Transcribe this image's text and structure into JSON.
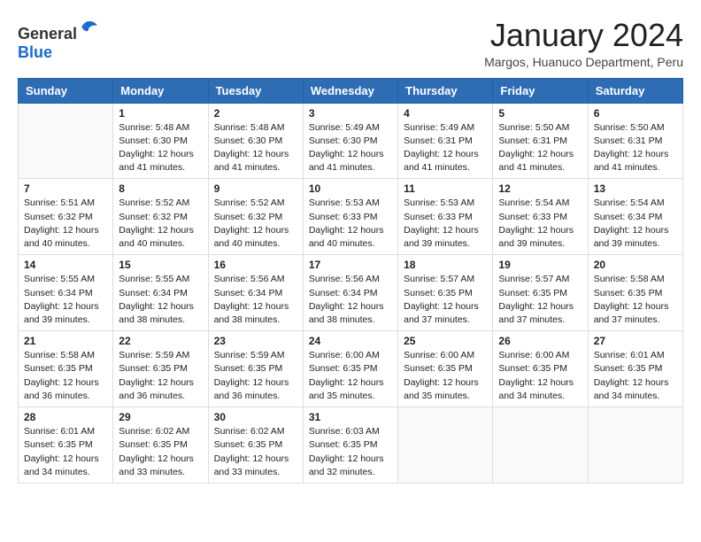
{
  "header": {
    "logo_general": "General",
    "logo_blue": "Blue",
    "month_title": "January 2024",
    "location": "Margos, Huanuco Department, Peru"
  },
  "weekdays": [
    "Sunday",
    "Monday",
    "Tuesday",
    "Wednesday",
    "Thursday",
    "Friday",
    "Saturday"
  ],
  "weeks": [
    [
      {
        "day": "",
        "empty": true
      },
      {
        "day": "1",
        "sunrise": "Sunrise: 5:48 AM",
        "sunset": "Sunset: 6:30 PM",
        "daylight": "Daylight: 12 hours and 41 minutes."
      },
      {
        "day": "2",
        "sunrise": "Sunrise: 5:48 AM",
        "sunset": "Sunset: 6:30 PM",
        "daylight": "Daylight: 12 hours and 41 minutes."
      },
      {
        "day": "3",
        "sunrise": "Sunrise: 5:49 AM",
        "sunset": "Sunset: 6:30 PM",
        "daylight": "Daylight: 12 hours and 41 minutes."
      },
      {
        "day": "4",
        "sunrise": "Sunrise: 5:49 AM",
        "sunset": "Sunset: 6:31 PM",
        "daylight": "Daylight: 12 hours and 41 minutes."
      },
      {
        "day": "5",
        "sunrise": "Sunrise: 5:50 AM",
        "sunset": "Sunset: 6:31 PM",
        "daylight": "Daylight: 12 hours and 41 minutes."
      },
      {
        "day": "6",
        "sunrise": "Sunrise: 5:50 AM",
        "sunset": "Sunset: 6:31 PM",
        "daylight": "Daylight: 12 hours and 41 minutes."
      }
    ],
    [
      {
        "day": "7",
        "sunrise": "Sunrise: 5:51 AM",
        "sunset": "Sunset: 6:32 PM",
        "daylight": "Daylight: 12 hours and 40 minutes."
      },
      {
        "day": "8",
        "sunrise": "Sunrise: 5:52 AM",
        "sunset": "Sunset: 6:32 PM",
        "daylight": "Daylight: 12 hours and 40 minutes."
      },
      {
        "day": "9",
        "sunrise": "Sunrise: 5:52 AM",
        "sunset": "Sunset: 6:32 PM",
        "daylight": "Daylight: 12 hours and 40 minutes."
      },
      {
        "day": "10",
        "sunrise": "Sunrise: 5:53 AM",
        "sunset": "Sunset: 6:33 PM",
        "daylight": "Daylight: 12 hours and 40 minutes."
      },
      {
        "day": "11",
        "sunrise": "Sunrise: 5:53 AM",
        "sunset": "Sunset: 6:33 PM",
        "daylight": "Daylight: 12 hours and 39 minutes."
      },
      {
        "day": "12",
        "sunrise": "Sunrise: 5:54 AM",
        "sunset": "Sunset: 6:33 PM",
        "daylight": "Daylight: 12 hours and 39 minutes."
      },
      {
        "day": "13",
        "sunrise": "Sunrise: 5:54 AM",
        "sunset": "Sunset: 6:34 PM",
        "daylight": "Daylight: 12 hours and 39 minutes."
      }
    ],
    [
      {
        "day": "14",
        "sunrise": "Sunrise: 5:55 AM",
        "sunset": "Sunset: 6:34 PM",
        "daylight": "Daylight: 12 hours and 39 minutes."
      },
      {
        "day": "15",
        "sunrise": "Sunrise: 5:55 AM",
        "sunset": "Sunset: 6:34 PM",
        "daylight": "Daylight: 12 hours and 38 minutes."
      },
      {
        "day": "16",
        "sunrise": "Sunrise: 5:56 AM",
        "sunset": "Sunset: 6:34 PM",
        "daylight": "Daylight: 12 hours and 38 minutes."
      },
      {
        "day": "17",
        "sunrise": "Sunrise: 5:56 AM",
        "sunset": "Sunset: 6:34 PM",
        "daylight": "Daylight: 12 hours and 38 minutes."
      },
      {
        "day": "18",
        "sunrise": "Sunrise: 5:57 AM",
        "sunset": "Sunset: 6:35 PM",
        "daylight": "Daylight: 12 hours and 37 minutes."
      },
      {
        "day": "19",
        "sunrise": "Sunrise: 5:57 AM",
        "sunset": "Sunset: 6:35 PM",
        "daylight": "Daylight: 12 hours and 37 minutes."
      },
      {
        "day": "20",
        "sunrise": "Sunrise: 5:58 AM",
        "sunset": "Sunset: 6:35 PM",
        "daylight": "Daylight: 12 hours and 37 minutes."
      }
    ],
    [
      {
        "day": "21",
        "sunrise": "Sunrise: 5:58 AM",
        "sunset": "Sunset: 6:35 PM",
        "daylight": "Daylight: 12 hours and 36 minutes."
      },
      {
        "day": "22",
        "sunrise": "Sunrise: 5:59 AM",
        "sunset": "Sunset: 6:35 PM",
        "daylight": "Daylight: 12 hours and 36 minutes."
      },
      {
        "day": "23",
        "sunrise": "Sunrise: 5:59 AM",
        "sunset": "Sunset: 6:35 PM",
        "daylight": "Daylight: 12 hours and 36 minutes."
      },
      {
        "day": "24",
        "sunrise": "Sunrise: 6:00 AM",
        "sunset": "Sunset: 6:35 PM",
        "daylight": "Daylight: 12 hours and 35 minutes."
      },
      {
        "day": "25",
        "sunrise": "Sunrise: 6:00 AM",
        "sunset": "Sunset: 6:35 PM",
        "daylight": "Daylight: 12 hours and 35 minutes."
      },
      {
        "day": "26",
        "sunrise": "Sunrise: 6:00 AM",
        "sunset": "Sunset: 6:35 PM",
        "daylight": "Daylight: 12 hours and 34 minutes."
      },
      {
        "day": "27",
        "sunrise": "Sunrise: 6:01 AM",
        "sunset": "Sunset: 6:35 PM",
        "daylight": "Daylight: 12 hours and 34 minutes."
      }
    ],
    [
      {
        "day": "28",
        "sunrise": "Sunrise: 6:01 AM",
        "sunset": "Sunset: 6:35 PM",
        "daylight": "Daylight: 12 hours and 34 minutes."
      },
      {
        "day": "29",
        "sunrise": "Sunrise: 6:02 AM",
        "sunset": "Sunset: 6:35 PM",
        "daylight": "Daylight: 12 hours and 33 minutes."
      },
      {
        "day": "30",
        "sunrise": "Sunrise: 6:02 AM",
        "sunset": "Sunset: 6:35 PM",
        "daylight": "Daylight: 12 hours and 33 minutes."
      },
      {
        "day": "31",
        "sunrise": "Sunrise: 6:03 AM",
        "sunset": "Sunset: 6:35 PM",
        "daylight": "Daylight: 12 hours and 32 minutes."
      },
      {
        "day": "",
        "empty": true
      },
      {
        "day": "",
        "empty": true
      },
      {
        "day": "",
        "empty": true
      }
    ]
  ]
}
